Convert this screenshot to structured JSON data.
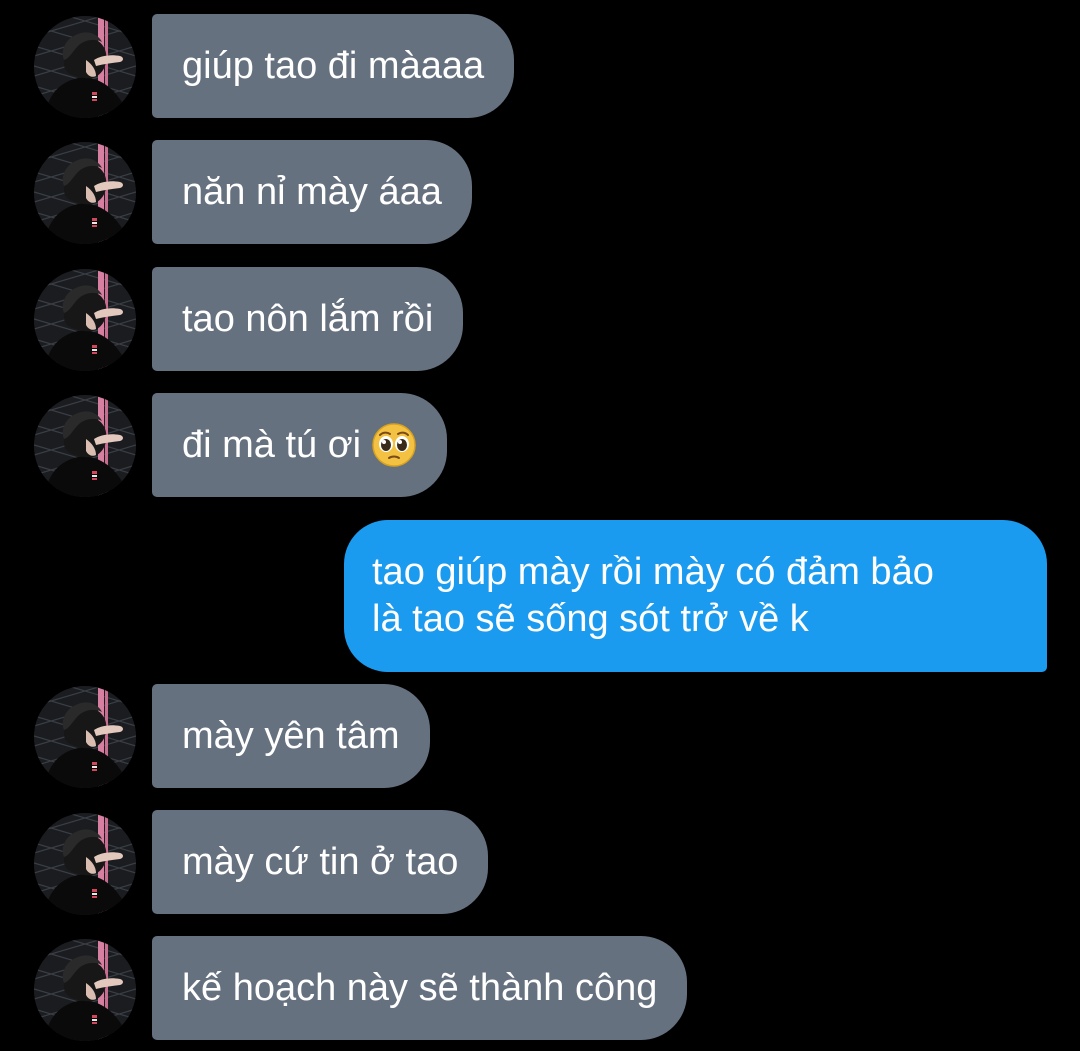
{
  "conversation": {
    "contact_avatar": "profile-photo-avatar",
    "messages": [
      {
        "sender": "them",
        "text": "giúp tao đi màaaa"
      },
      {
        "sender": "them",
        "text": "năn nỉ mày áaa"
      },
      {
        "sender": "them",
        "text": "tao nôn lắm rồi"
      },
      {
        "sender": "them",
        "text": "đi mà tú ơi",
        "emoji": "pleading-face-icon"
      },
      {
        "sender": "me",
        "lines": [
          "tao giúp mày rồi mày có đảm bảo",
          "là tao sẽ sống sót trở về k"
        ]
      },
      {
        "sender": "them",
        "text": "mày yên tâm"
      },
      {
        "sender": "them",
        "text": "mày cứ tin ở tao"
      },
      {
        "sender": "them",
        "text": "kế hoạch này sẽ thành công"
      }
    ]
  },
  "colors": {
    "background": "#000000",
    "incoming_bubble": "#66717f",
    "outgoing_bubble": "#1b9bf0",
    "text": "#ffffff"
  }
}
